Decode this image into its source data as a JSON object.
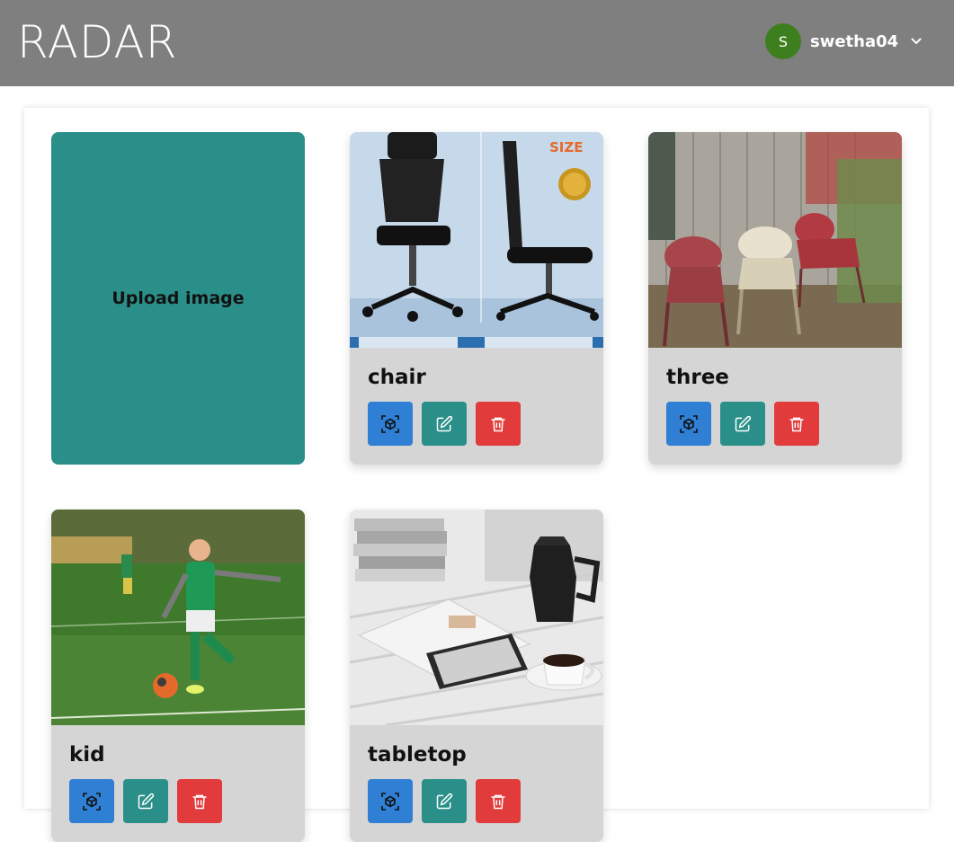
{
  "header": {
    "logo": "RADAR",
    "user": {
      "initial": "S",
      "name": "swetha04"
    }
  },
  "upload": {
    "label": "Upload image"
  },
  "cards": [
    {
      "title": "chair"
    },
    {
      "title": "three"
    },
    {
      "title": "kid"
    },
    {
      "title": "tabletop"
    }
  ],
  "icons": {
    "view": "cube-ar-icon",
    "edit": "edit-icon",
    "delete": "trash-icon"
  },
  "colors": {
    "header": "#7f7f7f",
    "upload_tile": "#2b8f89",
    "view_button": "#2f7fd4",
    "edit_button": "#2b8f89",
    "delete_button": "#e23b3b",
    "avatar": "#3d7f1f"
  }
}
